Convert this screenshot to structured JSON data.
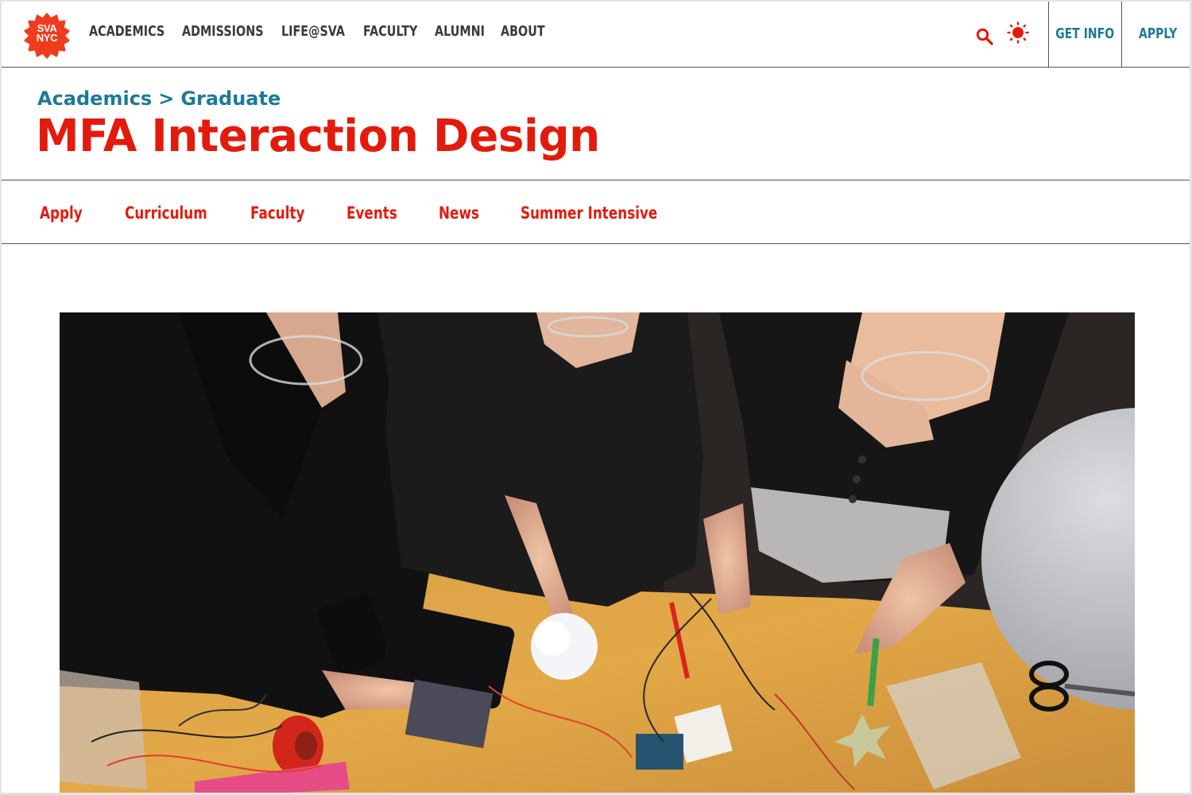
{
  "brand": {
    "logo_line1": "SVA",
    "logo_line2": "NYC",
    "logo_color": "#f03c1e"
  },
  "topnav": {
    "links": [
      "ACADEMICS",
      "ADMISSIONS",
      "LIFE@SVA",
      "FACULTY",
      "ALUMNI",
      "ABOUT"
    ],
    "search_icon": "search-icon",
    "theme_icon": "sun-icon",
    "get_info": "GET INFO",
    "apply": "APPLY"
  },
  "breadcrumb": {
    "items": [
      "Academics",
      "Graduate"
    ],
    "separator": ">"
  },
  "page_title": "MFA Interaction Design",
  "subnav": {
    "items": [
      "Apply",
      "Curriculum",
      "Faculty",
      "Events",
      "News",
      "Summer Intensive"
    ]
  },
  "hero": {
    "alt": "Three students wearing glasses working at a wooden table with phones, a paper flower, wires, breadboard, Arduino board, scissors and a desk lamp"
  },
  "colors": {
    "accent_red": "#e31b0c",
    "accent_teal": "#1b7a99",
    "nav_text": "#3a3a3a"
  }
}
